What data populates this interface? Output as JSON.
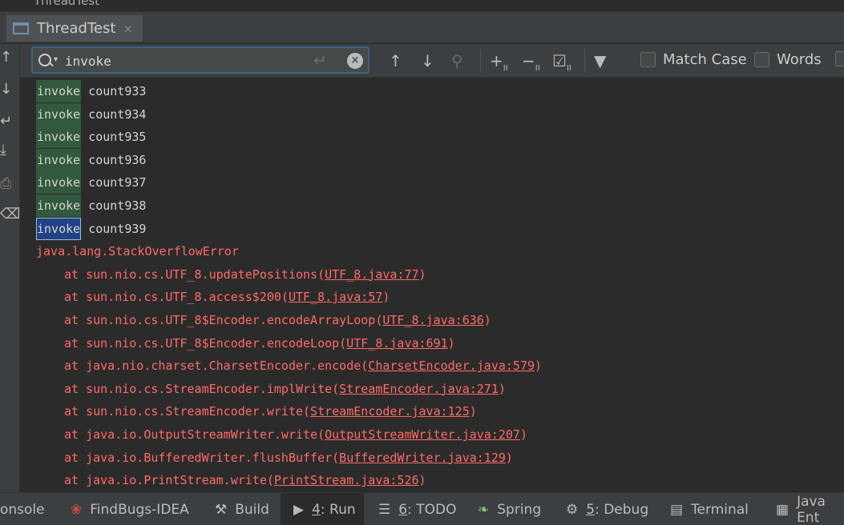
{
  "window": {
    "title": "ThreadTest"
  },
  "editor_tab": {
    "label": "ThreadTest",
    "close": "×"
  },
  "find_bar": {
    "query": "invoke",
    "match_case_label": "Match Case",
    "words_label": "Words"
  },
  "console": {
    "highlight_term": "invoke",
    "matches": [
      {
        "suffix": "count933",
        "current": false
      },
      {
        "suffix": "count934",
        "current": false
      },
      {
        "suffix": "count935",
        "current": false
      },
      {
        "suffix": "count936",
        "current": false
      },
      {
        "suffix": "count937",
        "current": false
      },
      {
        "suffix": "count938",
        "current": false
      },
      {
        "suffix": "count939",
        "current": true
      }
    ],
    "error": "java.lang.StackOverflowError",
    "stack": [
      {
        "at": "at sun.nio.cs.UTF_8.updatePositions(",
        "link": "UTF_8.java:77",
        "close": ")"
      },
      {
        "at": "at sun.nio.cs.UTF_8.access$200(",
        "link": "UTF_8.java:57",
        "close": ")"
      },
      {
        "at": "at sun.nio.cs.UTF_8$Encoder.encodeArrayLoop(",
        "link": "UTF_8.java:636",
        "close": ")"
      },
      {
        "at": "at sun.nio.cs.UTF_8$Encoder.encodeLoop(",
        "link": "UTF_8.java:691",
        "close": ")"
      },
      {
        "at": "at java.nio.charset.CharsetEncoder.encode(",
        "link": "CharsetEncoder.java:579",
        "close": ")"
      },
      {
        "at": "at sun.nio.cs.StreamEncoder.implWrite(",
        "link": "StreamEncoder.java:271",
        "close": ")"
      },
      {
        "at": "at sun.nio.cs.StreamEncoder.write(",
        "link": "StreamEncoder.java:125",
        "close": ")"
      },
      {
        "at": "at java.io.OutputStreamWriter.write(",
        "link": "OutputStreamWriter.java:207",
        "close": ")"
      },
      {
        "at": "at java.io.BufferedWriter.flushBuffer(",
        "link": "BufferedWriter.java:129",
        "close": ")"
      },
      {
        "at": "at java.io.PrintStream.write(",
        "link": "PrintStream.java:526",
        "close": ")"
      }
    ]
  },
  "bottom_tabs": {
    "console": "onsole",
    "findbugs": "FindBugs-IDEA",
    "build": "Build",
    "run_num": "4",
    "run": ": Run",
    "todo_num": "6",
    "todo": ": TODO",
    "spring": "Spring",
    "debug_num": "5",
    "debug": ": Debug",
    "terminal": "Terminal",
    "java_ent": "Java Ent"
  },
  "colors": {
    "match_highlight": "#32593d",
    "current_match": "#214283",
    "error_text": "#ff6b68",
    "search_border": "#3d6185"
  }
}
